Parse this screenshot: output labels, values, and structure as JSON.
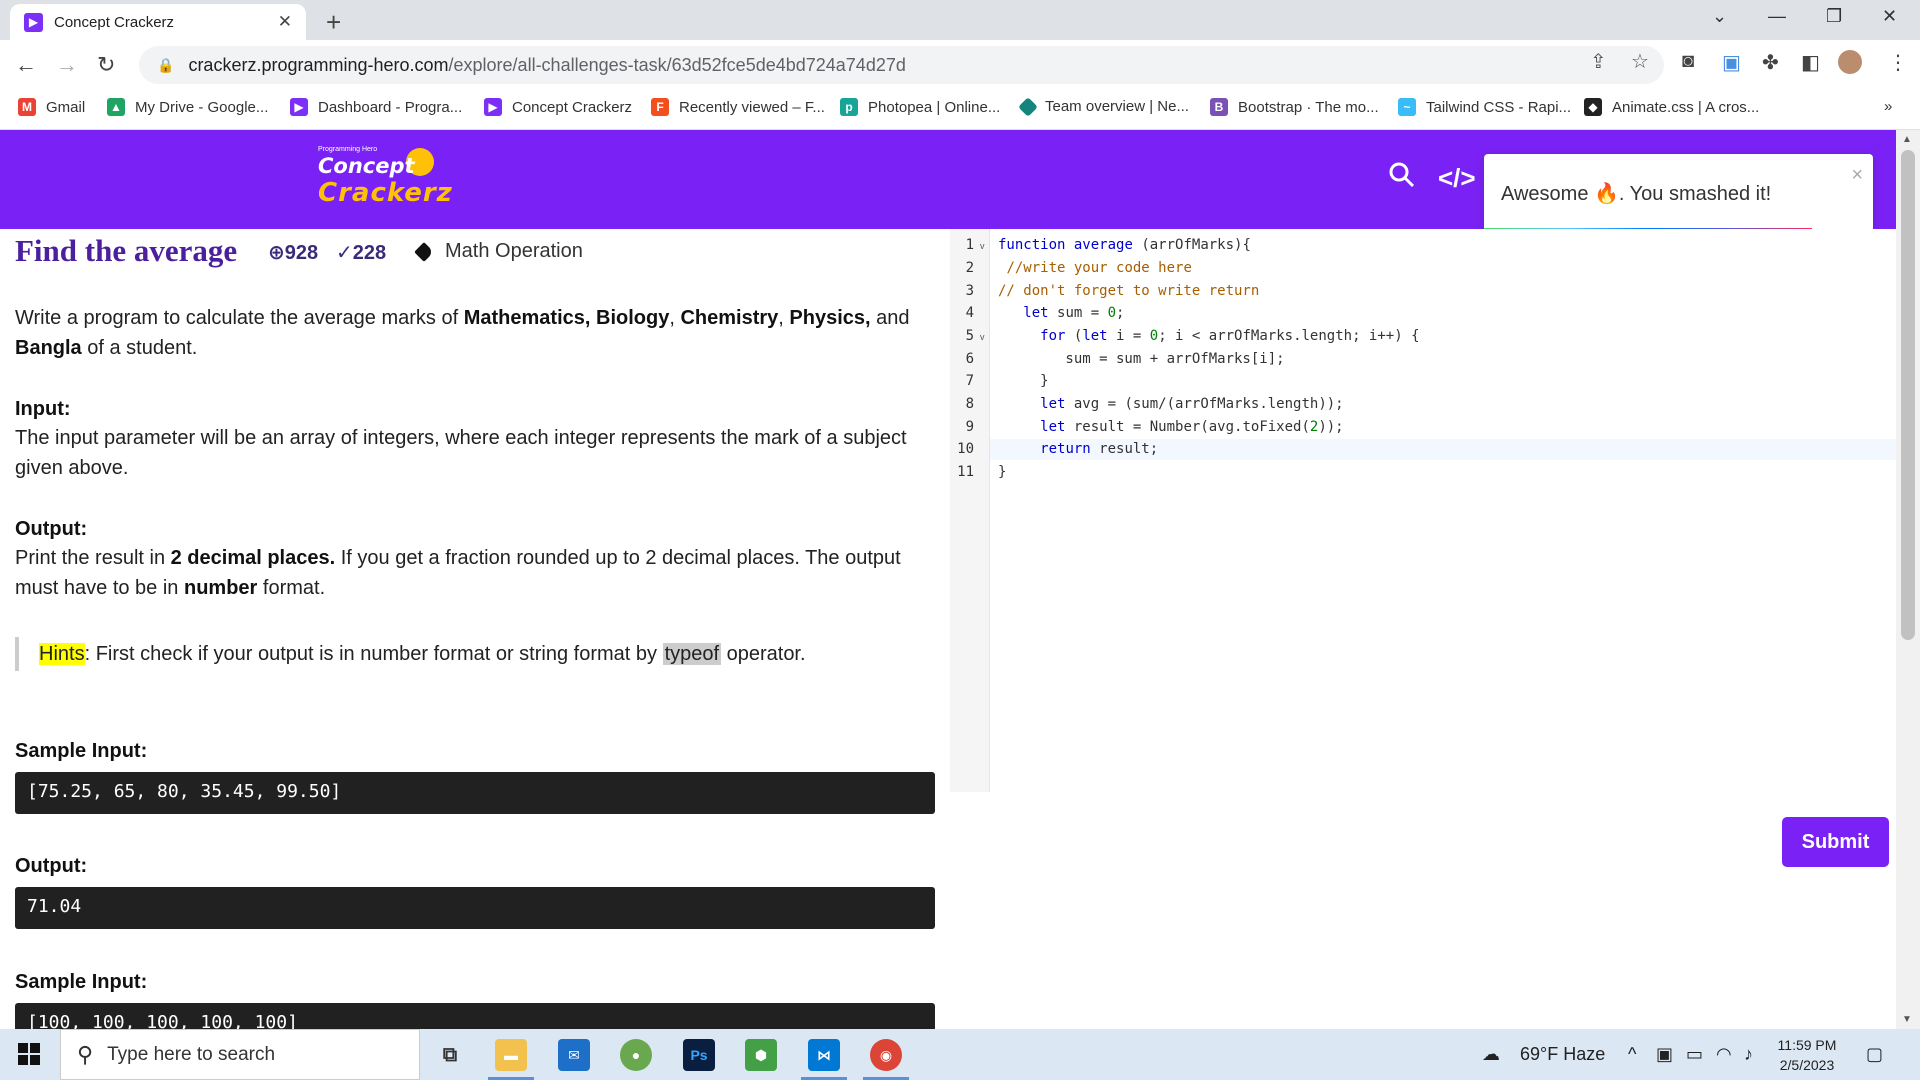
{
  "browser": {
    "tab_title": "Concept Crackerz",
    "url_host": "crackerz.programming-hero.com",
    "url_path": "/explore/all-challenges-task/63d52fce5de4bd724a74d27d",
    "bookmarks": [
      {
        "label": "Gmail",
        "icon": "gmail-icon",
        "color": "#ea4335"
      },
      {
        "label": "My Drive - Google...",
        "icon": "drive-icon",
        "color": "#1fa463"
      },
      {
        "label": "Dashboard - Progra...",
        "icon": "programming-hero-icon",
        "color": "#7b2ff7"
      },
      {
        "label": "Concept Crackerz",
        "icon": "programming-hero-icon",
        "color": "#7b2ff7"
      },
      {
        "label": "Recently viewed – F...",
        "icon": "figma-icon",
        "color": "#f24e1e"
      },
      {
        "label": "Photopea | Online...",
        "icon": "photopea-icon",
        "color": "#18a497"
      },
      {
        "label": "Team overview | Ne...",
        "icon": "netlify-icon",
        "color": "#15847d"
      },
      {
        "label": "Bootstrap · The mo...",
        "icon": "bootstrap-icon",
        "color": "#7952b3"
      },
      {
        "label": "Tailwind CSS - Rapi...",
        "icon": "tailwind-icon",
        "color": "#38bdf8"
      },
      {
        "label": "Animate.css | A cros...",
        "icon": "animate-icon",
        "color": "#222222"
      }
    ],
    "bookmarks_overflow": "»"
  },
  "site": {
    "logo_tagline": "Programming Hero",
    "logo_line1": "Concept",
    "logo_line2": "Crackerz"
  },
  "toast": {
    "text": "Awesome 🔥. You smashed it!",
    "close": "×"
  },
  "problem": {
    "title": "Find the average",
    "views": "928",
    "solved": "228",
    "category": "Math Operation",
    "desc_1": "Write a program to calculate the average marks of ",
    "desc_math": "Mathematics, Biology",
    "desc_comma": ", ",
    "desc_chem": "Chemistry",
    "desc_comma2": ", ",
    "desc_phys": "Physics,",
    "desc_and": " and",
    "desc_bangla": "Bangla",
    "desc_end": " of a student.",
    "input_label": "Input:",
    "input_text": "The input parameter will be an array of integers, where each integer represents the mark of a subject given above.",
    "output_label": "Output:",
    "output_1": "Print the result in ",
    "output_bold": "2 decimal places.",
    "output_2": " If you get a fraction rounded up to 2 decimal places. The output must have to be in ",
    "output_bold2": "number",
    "output_3": " format.",
    "hint_label": "Hints",
    "hint_1": ": First check if your output is in number format or string format by ",
    "hint_code": "typeof",
    "hint_2": " operator.",
    "sample_input_label": "Sample Input:",
    "sample_input": "[75.25, 65, 80, 35.45, 99.50]",
    "sample_output_label": "Output:",
    "sample_output": "71.04",
    "sample_input2_label": "Sample Input:",
    "sample_input2": "[100, 100, 100, 100, 100]"
  },
  "editor": {
    "line_numbers": [
      "1",
      "2",
      "3",
      "4",
      "5",
      "6",
      "7",
      "8",
      "9",
      "10",
      "11"
    ],
    "active_line": 10
  },
  "submit_label": "Submit",
  "taskbar": {
    "search_placeholder": "Type here to search",
    "weather": "69°F  Haze",
    "time": "11:59 PM",
    "date": "2/5/2023"
  }
}
